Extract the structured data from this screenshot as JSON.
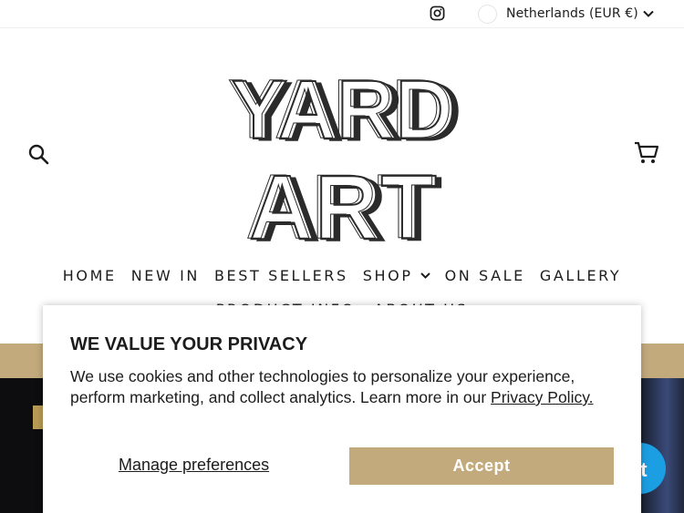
{
  "topbar": {
    "instagram_icon": "instagram-icon",
    "locale_label": "Netherlands (EUR €)"
  },
  "header": {
    "logo_text": "YARD ART",
    "search_icon": "search-icon",
    "cart_icon": "cart-icon"
  },
  "nav": {
    "items": [
      {
        "label": "HOME"
      },
      {
        "label": "NEW IN"
      },
      {
        "label": "BEST SELLERS"
      },
      {
        "label": "SHOP"
      },
      {
        "label": "ON SALE"
      },
      {
        "label": "GALLERY"
      }
    ],
    "items_row2": [
      {
        "label": "PRODUCT INFO"
      },
      {
        "label": "ABOUT US"
      }
    ]
  },
  "chat": {
    "label": "at"
  },
  "cookie": {
    "title": "WE VALUE YOUR PRIVACY",
    "body": "We use cookies and other technologies to personalize your experience, perform marketing, and collect analytics. Learn more in our ",
    "policy_link": "Privacy Policy.",
    "manage_label": "Manage preferences",
    "accept_label": "Accept"
  },
  "colors": {
    "accent": "#c3aa7d",
    "chat": "#1c9ee3",
    "text": "#1c1c1c"
  }
}
